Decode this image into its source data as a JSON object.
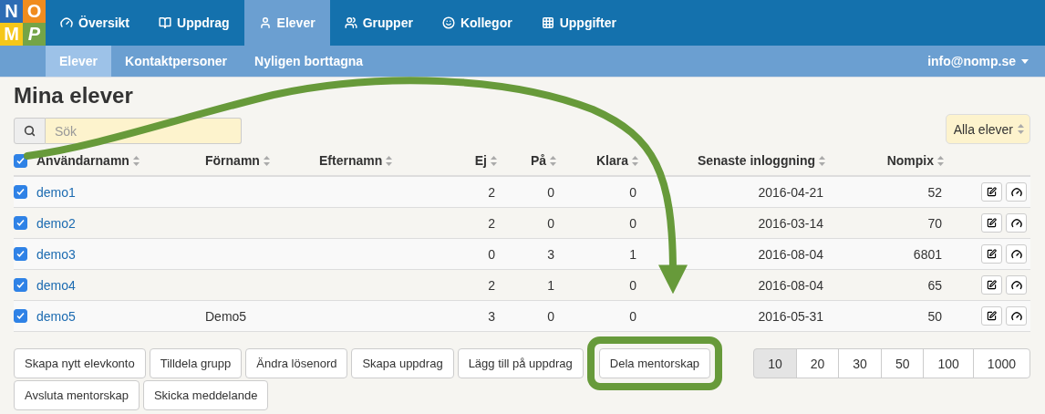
{
  "logo": [
    {
      "letter": "N",
      "color": "#2c6cb4"
    },
    {
      "letter": "O",
      "color": "#f08c1e"
    },
    {
      "letter": "M",
      "color": "#f5c71a"
    },
    {
      "letter": "P",
      "color": "#74a447"
    }
  ],
  "nav": [
    {
      "label": "Översikt",
      "selected": false
    },
    {
      "label": "Uppdrag",
      "selected": false
    },
    {
      "label": "Elever",
      "selected": true
    },
    {
      "label": "Grupper",
      "selected": false
    },
    {
      "label": "Kollegor",
      "selected": false
    },
    {
      "label": "Uppgifter",
      "selected": false
    }
  ],
  "subnav": [
    {
      "label": "Elever",
      "selected": true
    },
    {
      "label": "Kontaktpersoner",
      "selected": false
    },
    {
      "label": "Nyligen borttagna",
      "selected": false
    }
  ],
  "user_menu": "info@nomp.se",
  "title": "Mina elever",
  "search": {
    "placeholder": "Sök"
  },
  "filter": "Alla elever",
  "table": {
    "all_checked": true,
    "columns": [
      "Användarnamn",
      "Förnamn",
      "Efternamn",
      "Ej",
      "På",
      "Klara",
      "Senaste inloggning",
      "Nompix"
    ],
    "rows": [
      {
        "checked": true,
        "username": "demo1",
        "ej": "2",
        "pa": "0",
        "klara": "0",
        "last_login": "2016-04-21",
        "nompix": "52"
      },
      {
        "checked": true,
        "username": "demo2",
        "ej": "2",
        "pa": "0",
        "klara": "0",
        "last_login": "2016-03-14",
        "nompix": "70"
      },
      {
        "checked": true,
        "username": "demo3",
        "ej": "0",
        "pa": "3",
        "klara": "1",
        "last_login": "2016-08-04",
        "nompix": "6801"
      },
      {
        "checked": true,
        "username": "demo4",
        "ej": "2",
        "pa": "1",
        "klara": "0",
        "last_login": "2016-08-04",
        "nompix": "65"
      },
      {
        "checked": true,
        "username": "demo5",
        "first_name": "Demo5",
        "ej": "3",
        "pa": "0",
        "klara": "0",
        "last_login": "2016-05-31",
        "nompix": "50"
      }
    ]
  },
  "actions": [
    {
      "label": "Skapa nytt elevkonto",
      "highlighted": false
    },
    {
      "label": "Tilldela grupp",
      "highlighted": false
    },
    {
      "label": "Ändra lösenord",
      "highlighted": false
    },
    {
      "label": "Skapa uppdrag",
      "highlighted": false
    },
    {
      "label": "Lägg till på uppdrag",
      "highlighted": false
    },
    {
      "label": "Dela mentorskap",
      "highlighted": true
    },
    {
      "label": "Avsluta mentorskap",
      "highlighted": false
    },
    {
      "label": "Skicka meddelande",
      "highlighted": false
    }
  ],
  "page_sizes": [
    {
      "label": "10",
      "selected": true
    },
    {
      "label": "20",
      "selected": false
    },
    {
      "label": "30",
      "selected": false
    },
    {
      "label": "50",
      "selected": false
    },
    {
      "label": "100",
      "selected": false
    },
    {
      "label": "1000",
      "selected": false
    }
  ]
}
